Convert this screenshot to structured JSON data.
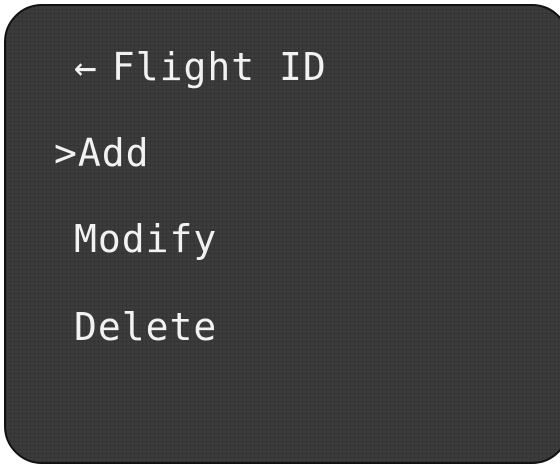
{
  "header": {
    "back_icon": "left-arrow-icon",
    "back_glyph": "←",
    "title": "Flight ID"
  },
  "menu": {
    "cursor_glyph": ">",
    "selected_index": 0,
    "items": [
      {
        "label": "Add"
      },
      {
        "label": "Modify"
      },
      {
        "label": "Delete"
      }
    ]
  },
  "colors": {
    "screen_background": "#3c3c3c",
    "text": "#f2f2f2",
    "border": "#111111"
  }
}
